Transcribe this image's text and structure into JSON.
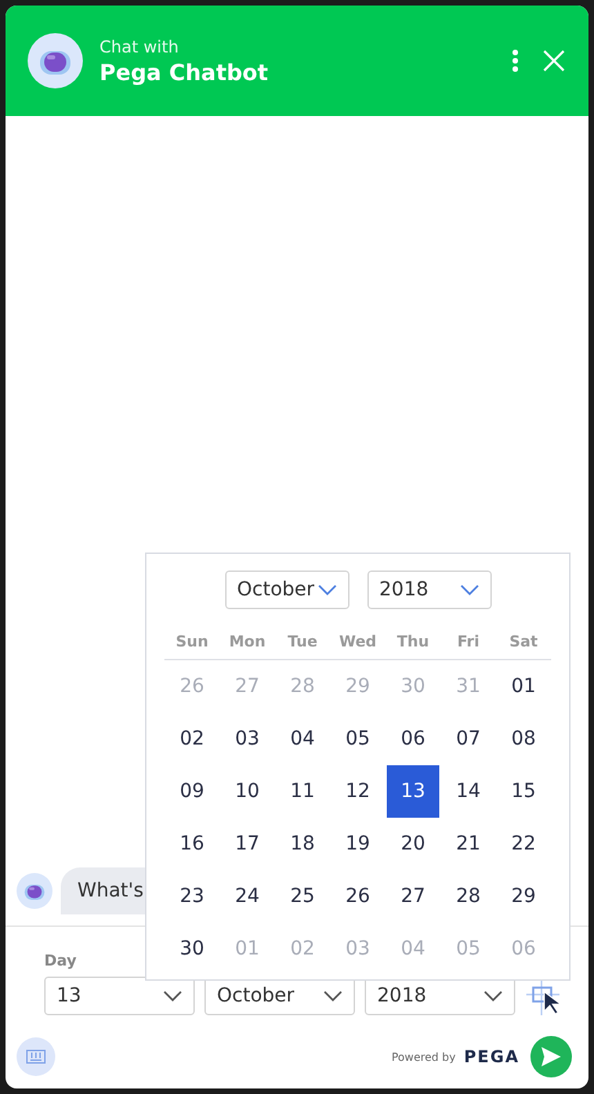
{
  "header": {
    "subtitle": "Chat with",
    "title": "Pega Chatbot"
  },
  "messages": [
    {
      "text": "What's"
    }
  ],
  "date_fields": {
    "label": "Day",
    "day": "13",
    "month": "October",
    "year": "2018"
  },
  "calendar": {
    "month": "October",
    "year": "2018",
    "weekdays": [
      "Sun",
      "Mon",
      "Tue",
      "Wed",
      "Thu",
      "Fri",
      "Sat"
    ],
    "weeks": [
      [
        {
          "text": "26",
          "muted": true,
          "selected": false
        },
        {
          "text": "27",
          "muted": true,
          "selected": false
        },
        {
          "text": "28",
          "muted": true,
          "selected": false
        },
        {
          "text": "29",
          "muted": true,
          "selected": false
        },
        {
          "text": "30",
          "muted": true,
          "selected": false
        },
        {
          "text": "31",
          "muted": true,
          "selected": false
        },
        {
          "text": "01",
          "muted": false,
          "selected": false
        }
      ],
      [
        {
          "text": "02",
          "muted": false,
          "selected": false
        },
        {
          "text": "03",
          "muted": false,
          "selected": false
        },
        {
          "text": "04",
          "muted": false,
          "selected": false
        },
        {
          "text": "05",
          "muted": false,
          "selected": false
        },
        {
          "text": "06",
          "muted": false,
          "selected": false
        },
        {
          "text": "07",
          "muted": false,
          "selected": false
        },
        {
          "text": "08",
          "muted": false,
          "selected": false
        }
      ],
      [
        {
          "text": "09",
          "muted": false,
          "selected": false
        },
        {
          "text": "10",
          "muted": false,
          "selected": false
        },
        {
          "text": "11",
          "muted": false,
          "selected": false
        },
        {
          "text": "12",
          "muted": false,
          "selected": false
        },
        {
          "text": "13",
          "muted": false,
          "selected": true
        },
        {
          "text": "14",
          "muted": false,
          "selected": false
        },
        {
          "text": "15",
          "muted": false,
          "selected": false
        }
      ],
      [
        {
          "text": "16",
          "muted": false,
          "selected": false
        },
        {
          "text": "17",
          "muted": false,
          "selected": false
        },
        {
          "text": "18",
          "muted": false,
          "selected": false
        },
        {
          "text": "19",
          "muted": false,
          "selected": false
        },
        {
          "text": "20",
          "muted": false,
          "selected": false
        },
        {
          "text": "21",
          "muted": false,
          "selected": false
        },
        {
          "text": "22",
          "muted": false,
          "selected": false
        }
      ],
      [
        {
          "text": "23",
          "muted": false,
          "selected": false
        },
        {
          "text": "24",
          "muted": false,
          "selected": false
        },
        {
          "text": "25",
          "muted": false,
          "selected": false
        },
        {
          "text": "26",
          "muted": false,
          "selected": false
        },
        {
          "text": "27",
          "muted": false,
          "selected": false
        },
        {
          "text": "28",
          "muted": false,
          "selected": false
        },
        {
          "text": "29",
          "muted": false,
          "selected": false
        }
      ],
      [
        {
          "text": "30",
          "muted": false,
          "selected": false
        },
        {
          "text": "01",
          "muted": true,
          "selected": false
        },
        {
          "text": "02",
          "muted": true,
          "selected": false
        },
        {
          "text": "03",
          "muted": true,
          "selected": false
        },
        {
          "text": "04",
          "muted": true,
          "selected": false
        },
        {
          "text": "05",
          "muted": true,
          "selected": false
        },
        {
          "text": "06",
          "muted": true,
          "selected": false
        }
      ]
    ]
  },
  "footer": {
    "powered_by": "Powered by",
    "brand": "PEGA"
  }
}
